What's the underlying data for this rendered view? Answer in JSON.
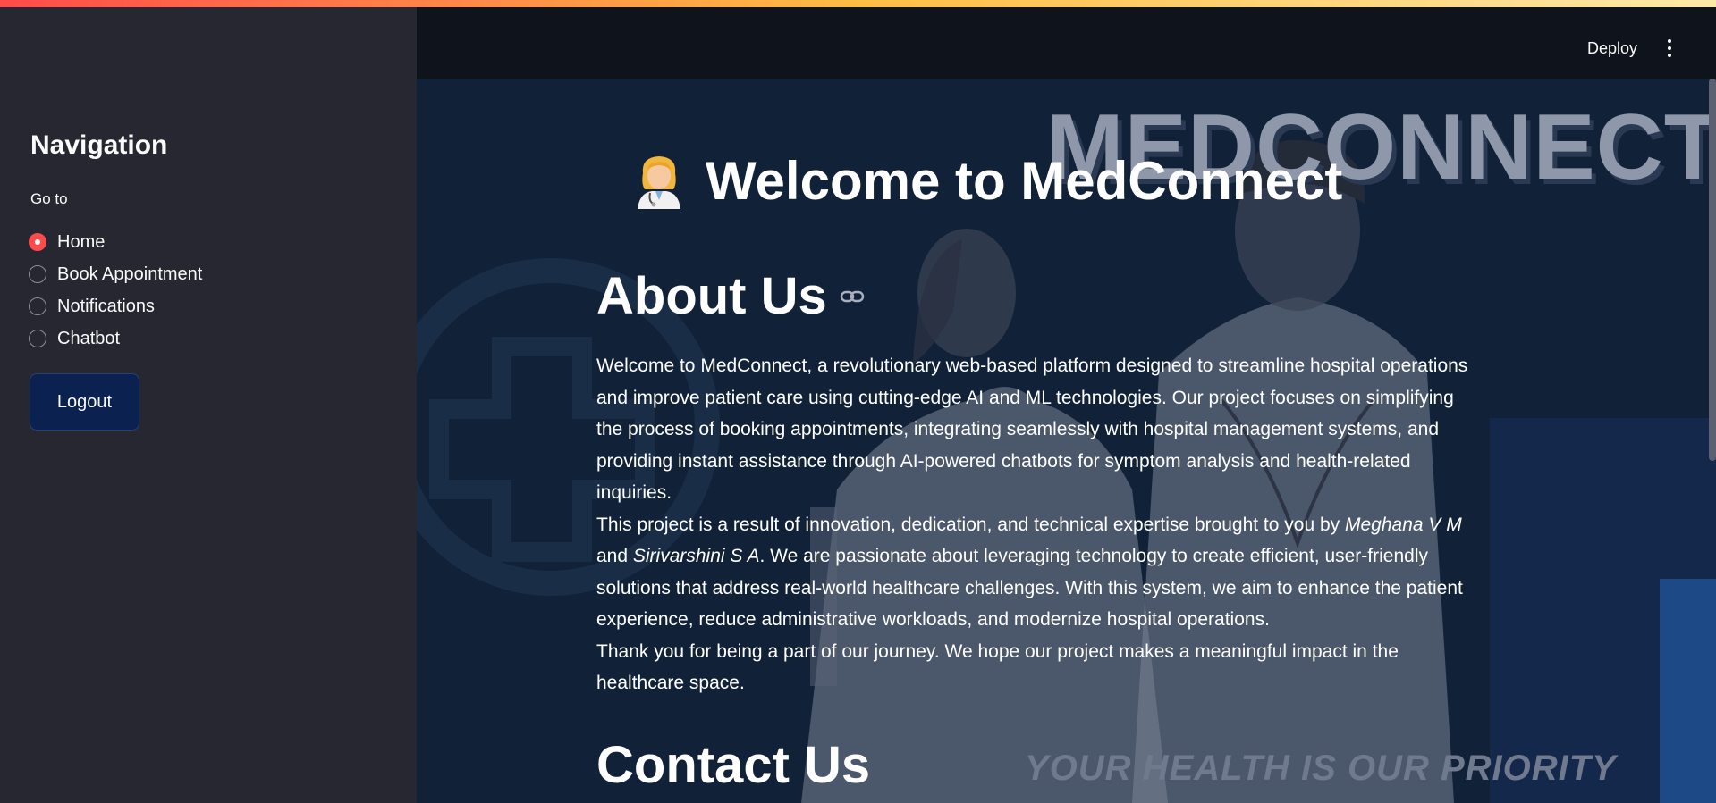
{
  "sidebar": {
    "title": "Navigation",
    "goto_label": "Go to",
    "options": [
      {
        "label": "Home",
        "selected": true
      },
      {
        "label": "Book Appointment",
        "selected": false
      },
      {
        "label": "Notifications",
        "selected": false
      },
      {
        "label": "Chatbot",
        "selected": false
      }
    ],
    "logout_label": "Logout"
  },
  "header": {
    "deploy_label": "Deploy",
    "menu_icon": "kebab-menu-icon"
  },
  "background": {
    "brand": "MEDCONNECT",
    "slogan": "YOUR HEALTH IS OUR PRIORITY"
  },
  "main": {
    "title": "Welcome to MedConnect",
    "title_icon": "health-worker-emoji",
    "about_heading": "About Us",
    "about_p1": "Welcome to MedConnect, a revolutionary web-based platform designed to streamline hospital operations and improve patient care using cutting-edge AI and ML technologies. Our project focuses on simplifying the process of booking appointments, integrating seamlessly with hospital management systems, and providing instant assistance through AI-powered chatbots for symptom analysis and health-related inquiries.",
    "about_p2_start": "This project is a result of innovation, dedication, and technical expertise brought to you by ",
    "author1": "Meghana V M",
    "about_p2_and": " and ",
    "author2": "Sirivarshini S A",
    "about_p2_end": ". We are passionate about leveraging technology to create efficient, user-friendly solutions that address real-world healthcare challenges. With this system, we aim to enhance the patient experience, reduce administrative workloads, and modernize hospital operations.",
    "about_p3": "Thank you for being a part of our journey. We hope our project makes a meaningful impact in the healthcare space.",
    "contact_heading": "Contact Us"
  },
  "colors": {
    "accent": "#ff4b4b",
    "sidebar_bg": "#262730",
    "main_bg": "#112238",
    "button_bg": "#0b2150"
  }
}
